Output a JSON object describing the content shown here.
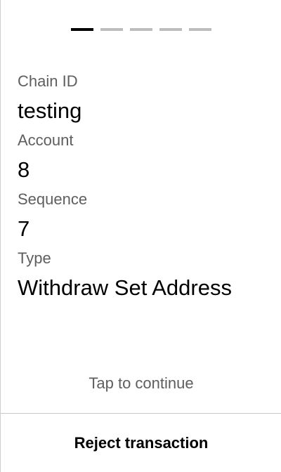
{
  "pager": {
    "total_pages": 5,
    "current_page": 1
  },
  "fields": [
    {
      "label": "Chain ID",
      "value": "testing"
    },
    {
      "label": "Account",
      "value": "8"
    },
    {
      "label": "Sequence",
      "value": "7"
    },
    {
      "label": "Type",
      "value": "Withdraw Set Address"
    }
  ],
  "footer": {
    "tap_hint": "Tap to continue",
    "reject_label": "Reject transaction"
  },
  "colors": {
    "active_dash": "#000000",
    "inactive_dash": "#bdbdbd",
    "label_text": "#5e5e5e",
    "value_text": "#000000"
  }
}
